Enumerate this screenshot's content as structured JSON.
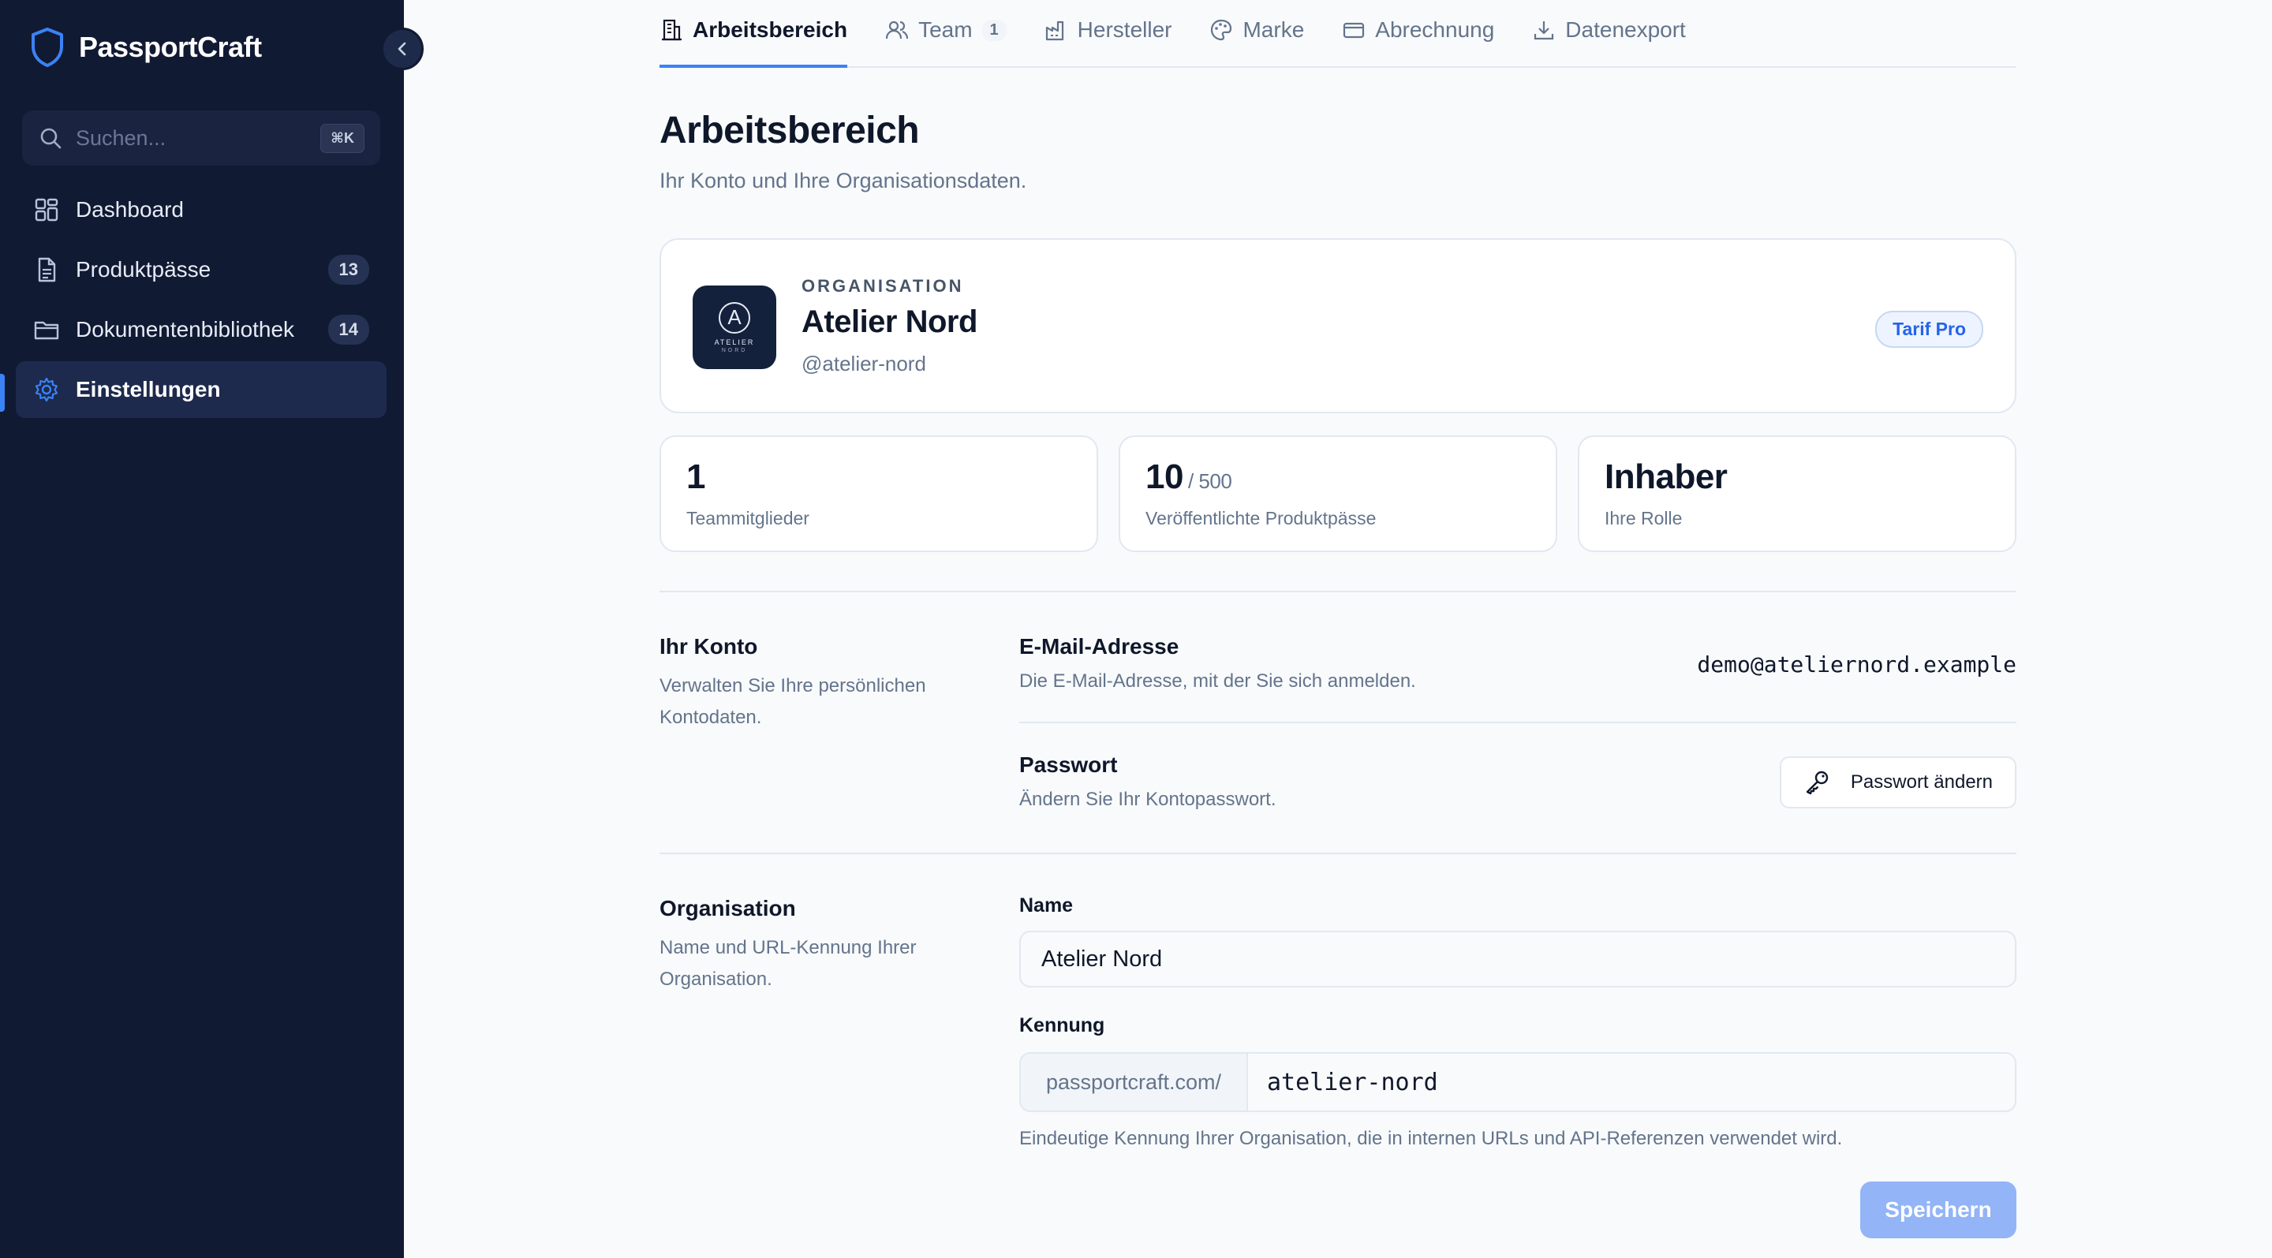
{
  "app": {
    "name": "PassportCraft",
    "accent_color": "#3b82f6",
    "sidebar_bg": "#111a33"
  },
  "search": {
    "placeholder": "Suchen...",
    "shortcut": "⌘K"
  },
  "sidebar": {
    "items": [
      {
        "label": "Dashboard",
        "icon": "grid-icon",
        "count": null,
        "active": false
      },
      {
        "label": "Produktpässe",
        "icon": "document-icon",
        "count": "13",
        "active": false
      },
      {
        "label": "Dokumentenbibliothek",
        "icon": "folder-icon",
        "count": "14",
        "active": false
      },
      {
        "label": "Einstellungen",
        "icon": "gear-icon",
        "count": null,
        "active": true
      }
    ]
  },
  "tabs": [
    {
      "label": "Arbeitsbereich",
      "icon": "building-icon",
      "active": true
    },
    {
      "label": "Team",
      "icon": "users-icon",
      "count": "1"
    },
    {
      "label": "Hersteller",
      "icon": "factory-icon"
    },
    {
      "label": "Marke",
      "icon": "palette-icon"
    },
    {
      "label": "Abrechnung",
      "icon": "credit-card-icon"
    },
    {
      "label": "Datenexport",
      "icon": "download-icon"
    }
  ],
  "page": {
    "title": "Arbeitsbereich",
    "subtitle": "Ihr Konto und Ihre Organisationsdaten."
  },
  "organization": {
    "eyebrow": "ORGANISATION",
    "name": "Atelier Nord",
    "handle": "@atelier-nord",
    "plan": "Tarif Pro",
    "logo_letter": "A",
    "logo_line1": "ATELIER",
    "logo_line2": "NORD"
  },
  "stats": [
    {
      "value": "1",
      "suffix": "",
      "label": "Teammitglieder"
    },
    {
      "value": "10",
      "suffix": "/ 500",
      "label": "Veröffentlichte Produktpässe"
    },
    {
      "value": "Inhaber",
      "suffix": "",
      "label": "Ihre Rolle"
    }
  ],
  "account": {
    "title": "Ihr Konto",
    "description": "Verwalten Sie Ihre persönlichen Kontodaten.",
    "email_label": "E-Mail-Adresse",
    "email_desc": "Die E-Mail-Adresse, mit der Sie sich anmelden.",
    "email_value": "demo@ateliernord.example",
    "password_label": "Passwort",
    "password_desc": "Ändern Sie Ihr Kontopasswort.",
    "password_button": "Passwort ändern"
  },
  "org_form": {
    "title": "Organisation",
    "description": "Name und URL-Kennung Ihrer Organisation.",
    "name_label": "Name",
    "name_value": "Atelier Nord",
    "slug_label": "Kennung",
    "slug_prefix": "passportcraft.com/",
    "slug_value": "atelier-nord",
    "slug_hint": "Eindeutige Kennung Ihrer Organisation, die in internen URLs und API-Referenzen verwendet wird.",
    "save_button": "Speichern"
  }
}
